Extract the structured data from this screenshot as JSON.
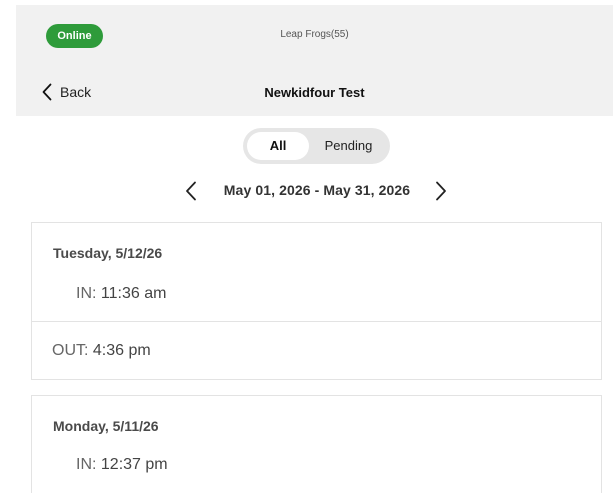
{
  "header": {
    "status": "Online",
    "classroom": "Leap Frogs(55)",
    "back_label": "Back",
    "child_name": "Newkidfour Test"
  },
  "filter": {
    "all_label": "All",
    "pending_label": "Pending",
    "selected": "All"
  },
  "date_range": "May 01, 2026 - May 31, 2026",
  "days": [
    {
      "label": "Tuesday,  5/12/26",
      "in_label": "IN:",
      "in_time": "11:36 am",
      "out_label": "OUT:",
      "out_time": "4:36 pm"
    },
    {
      "label": "Monday,  5/11/26",
      "in_label": "IN:",
      "in_time": "12:37 pm"
    }
  ],
  "colors": {
    "online_green": "#2e9b3a",
    "header_bg": "#f1f1f1",
    "segment_bg": "#e6e6e6"
  },
  "icons": {
    "back": "chevron-left-icon",
    "prev": "chevron-left-icon",
    "next": "chevron-right-icon"
  }
}
